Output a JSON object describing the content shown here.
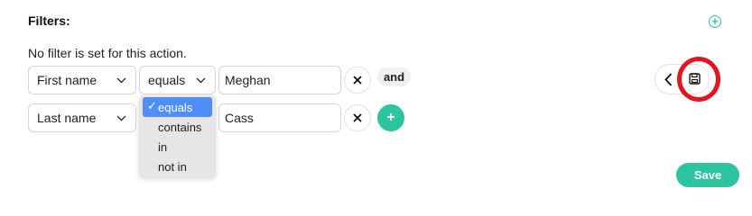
{
  "filters": {
    "title": "Filters:",
    "empty_message": "No filter is set for this action."
  },
  "rows": [
    {
      "field": "First name",
      "operator": "equals",
      "value": "Meghan",
      "connector": "and"
    },
    {
      "field": "Last name",
      "operator": "equals",
      "value": "Cass",
      "add_label": "+"
    }
  ],
  "operator_dropdown": {
    "options": [
      "equals",
      "contains",
      "in",
      "not in"
    ],
    "selected": "equals",
    "check": "✓"
  },
  "actions": {
    "add_filter_label": "+",
    "save_label": "Save"
  },
  "colors": {
    "accent": "#2dc5a0",
    "selection": "#4f8ef7",
    "highlight": "#e5151f"
  },
  "icons": [
    "chevron-down-icon",
    "close-icon",
    "chevron-left-icon",
    "floppy-disk-icon",
    "plus-icon"
  ]
}
